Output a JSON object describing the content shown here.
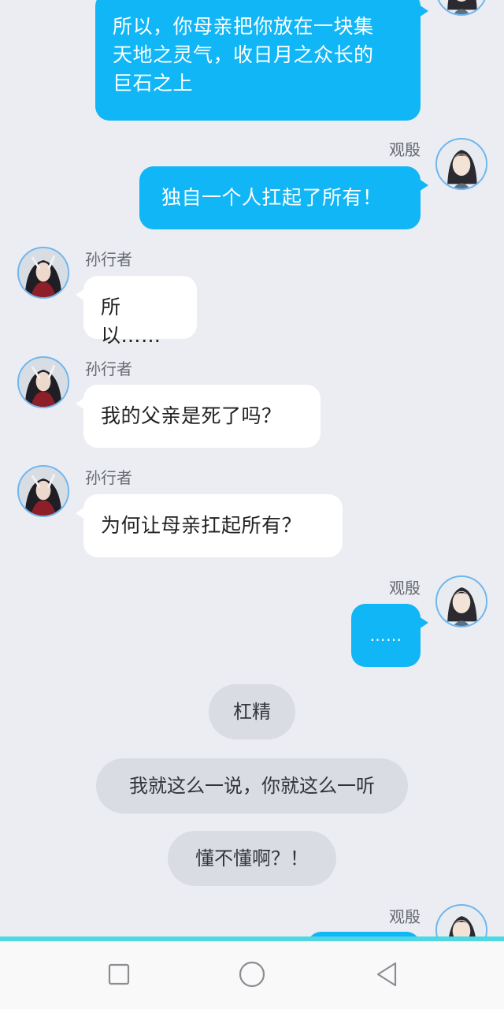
{
  "messages": [
    {
      "side": "right",
      "sender": "",
      "text": "所以，你母亲把你放在一块集\n天地之灵气，收日月之众长的\n巨石之上"
    },
    {
      "side": "right",
      "sender": "观殷",
      "text": "独自一个人扛起了所有！"
    },
    {
      "side": "left",
      "sender": "孙行者",
      "text": "所以……"
    },
    {
      "side": "left",
      "sender": "孙行者",
      "text": "我的父亲是死了吗？"
    },
    {
      "side": "left",
      "sender": "孙行者",
      "text": "为何让母亲扛起所有？"
    },
    {
      "side": "right",
      "sender": "观殷",
      "text": "……"
    },
    {
      "side": "right",
      "sender": "观殷",
      "text": ""
    }
  ],
  "pills": [
    "杠精",
    "我就这么一说，你就这么一听",
    "懂不懂啊？！"
  ],
  "colors": {
    "background": "#ebedf2",
    "right_bubble": "#10b6f5",
    "left_bubble": "#ffffff",
    "pill": "#d9dce3",
    "nav_accent": "#4fd7e4"
  },
  "avatars": {
    "guanyin": "male-avatar-long-hair",
    "sunxingzhe": "male-avatar-dark-red"
  },
  "nav": {
    "recents": "square-icon",
    "home": "circle-icon",
    "back": "triangle-back-icon"
  }
}
